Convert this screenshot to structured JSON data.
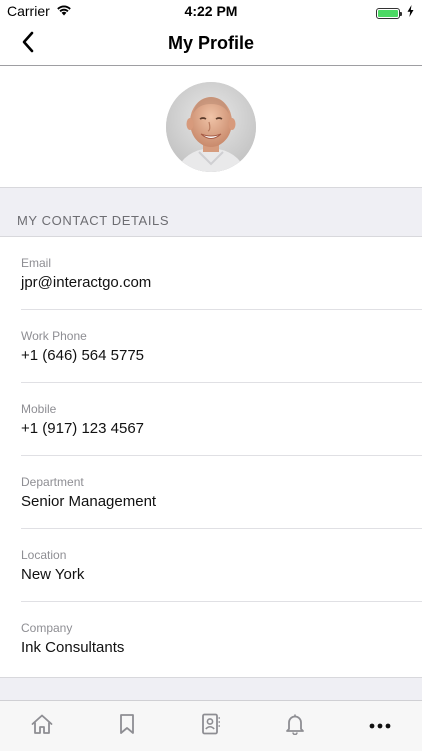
{
  "status_bar": {
    "carrier": "Carrier",
    "time": "4:22 PM",
    "battery_level": 1.0,
    "battery_color": "#4cd964"
  },
  "nav": {
    "title": "My Profile",
    "back_icon": "chevron-left-icon"
  },
  "avatar": {
    "alt": "Profile photo"
  },
  "section": {
    "header": "MY CONTACT DETAILS"
  },
  "details": [
    {
      "label": "Email",
      "value": "jpr@interactgo.com"
    },
    {
      "label": "Work Phone",
      "value": "+1 (646) 564 5775"
    },
    {
      "label": "Mobile",
      "value": "+1 (917) 123 4567"
    },
    {
      "label": "Department",
      "value": "Senior Management"
    },
    {
      "label": "Location",
      "value": "New York"
    },
    {
      "label": "Company",
      "value": "Ink Consultants"
    }
  ],
  "tab_bar": {
    "items": [
      {
        "icon": "home-icon"
      },
      {
        "icon": "bookmark-icon"
      },
      {
        "icon": "contacts-icon"
      },
      {
        "icon": "bell-icon"
      },
      {
        "icon": "more-icon"
      }
    ]
  }
}
